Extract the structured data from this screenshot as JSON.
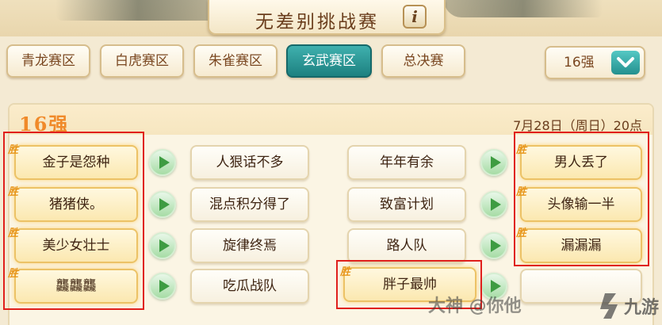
{
  "title": "无差别挑战赛",
  "info_icon_label": "i",
  "tabs": [
    {
      "label": "青龙赛区",
      "active": false
    },
    {
      "label": "白虎赛区",
      "active": false
    },
    {
      "label": "朱雀赛区",
      "active": false
    },
    {
      "label": "玄武赛区",
      "active": true
    },
    {
      "label": "总决赛",
      "active": false
    }
  ],
  "round_select": {
    "value": "16强"
  },
  "stage": {
    "label": "16强",
    "date": "7月28日（周日）20点"
  },
  "win_label": "胜",
  "left_matches": [
    {
      "winner": "金子是怨种",
      "loser": "人狠话不多"
    },
    {
      "winner": "猪猪侠。",
      "loser": "混点积分得了"
    },
    {
      "winner": "美少女壮士",
      "loser": "旋律终焉"
    },
    {
      "winner": "龘龘龘",
      "loser": "吃瓜战队"
    }
  ],
  "right_matches": [
    {
      "loser": "年年有余",
      "winner": "男人丢了"
    },
    {
      "loser": "致富计划",
      "winner": "头像输一半"
    },
    {
      "loser": "路人队",
      "winner": "漏漏漏"
    },
    {
      "loser": "",
      "winner": "胖子最帅"
    }
  ],
  "watermark_text": "大神 @你他",
  "logo_text": "九游",
  "colors": {
    "active_tab": "#1d8180",
    "stage_label": "#f08a2a",
    "win_mark": "#e8961c",
    "highlight_box": "#e0201c"
  }
}
